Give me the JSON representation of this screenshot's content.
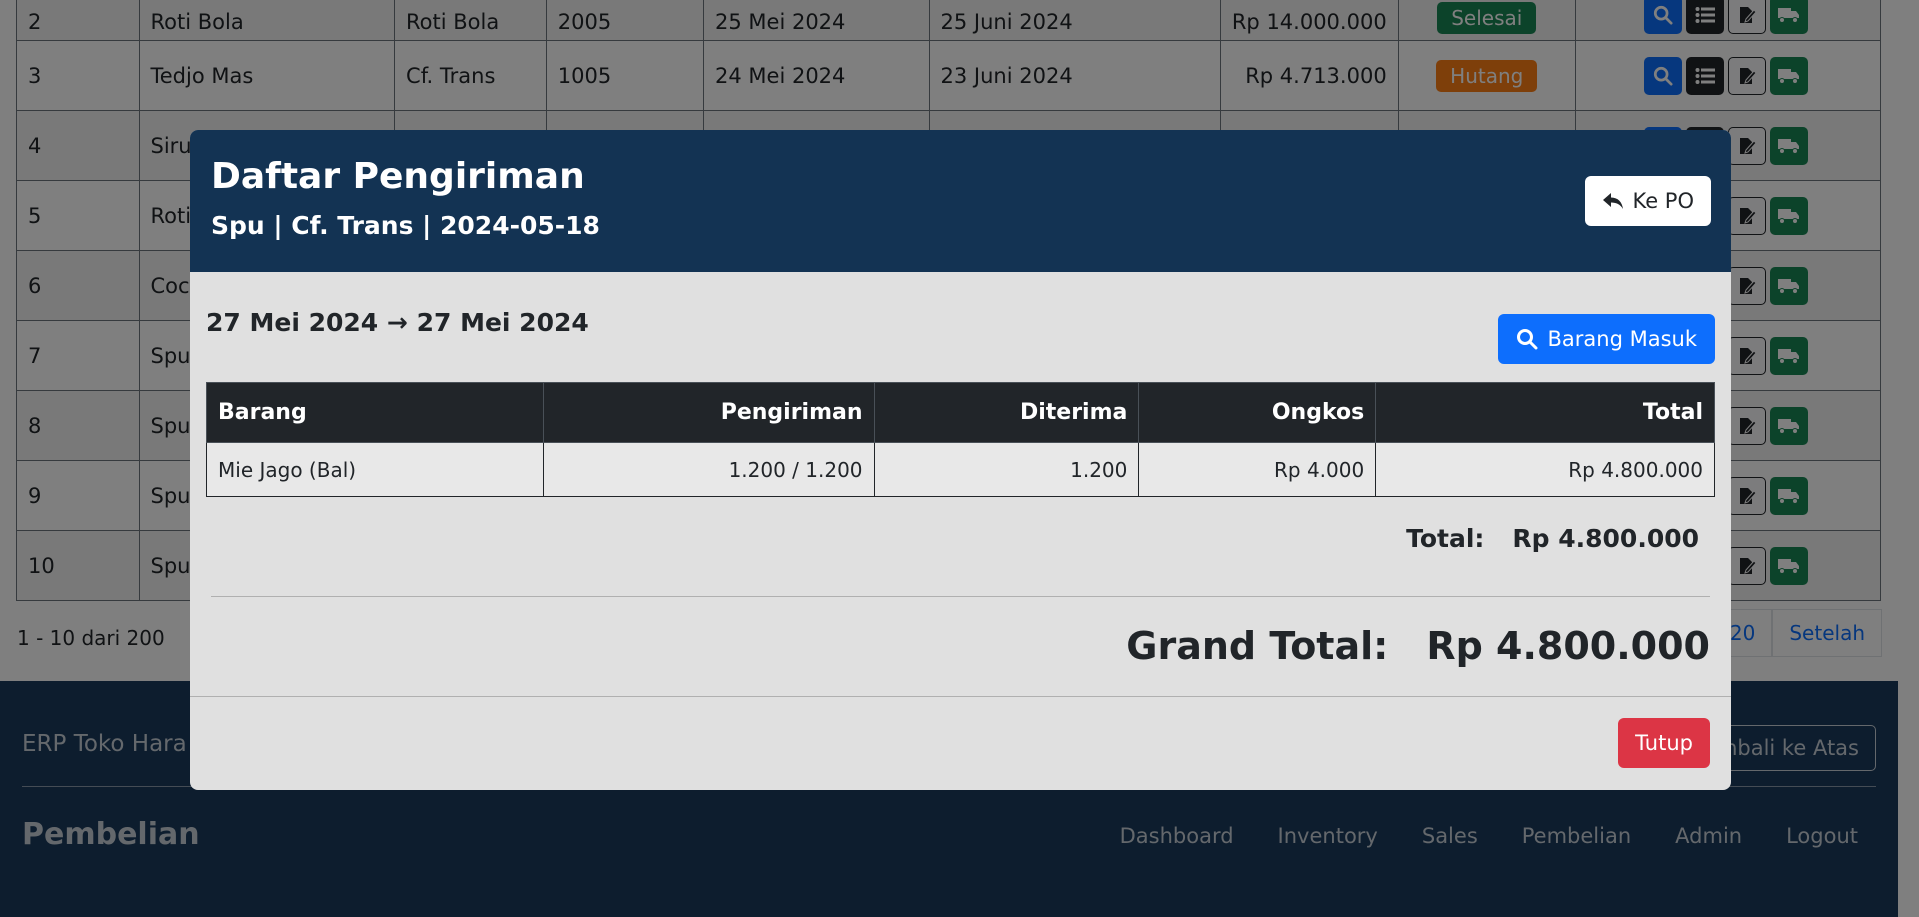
{
  "background": {
    "rows": [
      {
        "no": "2",
        "supplier": "Roti Bola",
        "driver": "Roti Bola",
        "code": "2005",
        "date": "25 Mei 2024",
        "due": "25 Juni 2024",
        "amount": "Rp 14.000.000",
        "status": "Selesai",
        "status_color": "#198754"
      },
      {
        "no": "3",
        "supplier": "Tedjo Mas",
        "driver": "Cf. Trans",
        "code": "1005",
        "date": "24 Mei 2024",
        "due": "23 Juni 2024",
        "amount": "Rp 4.713.000",
        "status": "Hutang",
        "status_color": "#fd7e14"
      },
      {
        "no": "4",
        "supplier": "Siru",
        "driver": "",
        "code": "",
        "date": "",
        "due": "",
        "amount": "",
        "status": "",
        "status_color": "#fd7e14"
      },
      {
        "no": "5",
        "supplier": "Roti",
        "driver": "",
        "code": "",
        "date": "",
        "due": "",
        "amount": "",
        "status": "",
        "status_color": ""
      },
      {
        "no": "6",
        "supplier": "Coc",
        "driver": "",
        "code": "",
        "date": "",
        "due": "",
        "amount": "",
        "status": "",
        "status_color": ""
      },
      {
        "no": "7",
        "supplier": "Spu",
        "driver": "",
        "code": "",
        "date": "",
        "due": "",
        "amount": "",
        "status": "",
        "status_color": ""
      },
      {
        "no": "8",
        "supplier": "Spu",
        "driver": "",
        "code": "",
        "date": "",
        "due": "",
        "amount": "",
        "status": "",
        "status_color": ""
      },
      {
        "no": "9",
        "supplier": "Spu",
        "driver": "",
        "code": "",
        "date": "",
        "due": "",
        "amount": "",
        "status": "",
        "status_color": ""
      },
      {
        "no": "10",
        "supplier": "Spu",
        "driver": "",
        "code": "",
        "date": "",
        "due": "",
        "amount": "",
        "status": "",
        "status_color": ""
      }
    ],
    "pagination": {
      "info": "1 - 10 dari 200",
      "last_page": "20",
      "next": "Setelah"
    },
    "footer": {
      "brand": "ERP Toko Hara",
      "back_to_top": "mbali ke Atas",
      "section_title": "Pembelian",
      "nav": [
        "Dashboard",
        "Inventory",
        "Sales",
        "Pembelian",
        "Admin",
        "Logout"
      ]
    }
  },
  "modal": {
    "title": "Daftar Pengiriman",
    "subtitle": "Spu | Cf. Trans | 2024-05-18",
    "back_button": "Ke PO",
    "date_range": {
      "from": "27 Mei 2024",
      "arrow": "→",
      "to": "27 Mei 2024"
    },
    "search_button": "Barang Masuk",
    "table": {
      "headers": [
        "Barang",
        "Pengiriman",
        "Diterima",
        "Ongkos",
        "Total"
      ],
      "rows": [
        [
          "Mie Jago (Bal)",
          "1.200 / 1.200",
          "1.200",
          "Rp 4.000",
          "Rp 4.800.000"
        ]
      ]
    },
    "subtotal_label": "Total:",
    "subtotal_value": "Rp 4.800.000",
    "grand_total_label": "Grand Total:",
    "grand_total_value": "Rp 4.800.000",
    "close_button": "Tutup"
  },
  "colors": {
    "header_bg": "#133353",
    "primary": "#0d6efd",
    "danger": "#dc3545",
    "success": "#198754",
    "warning": "#fd7e14",
    "footer_bg": "#1a3a5c"
  }
}
